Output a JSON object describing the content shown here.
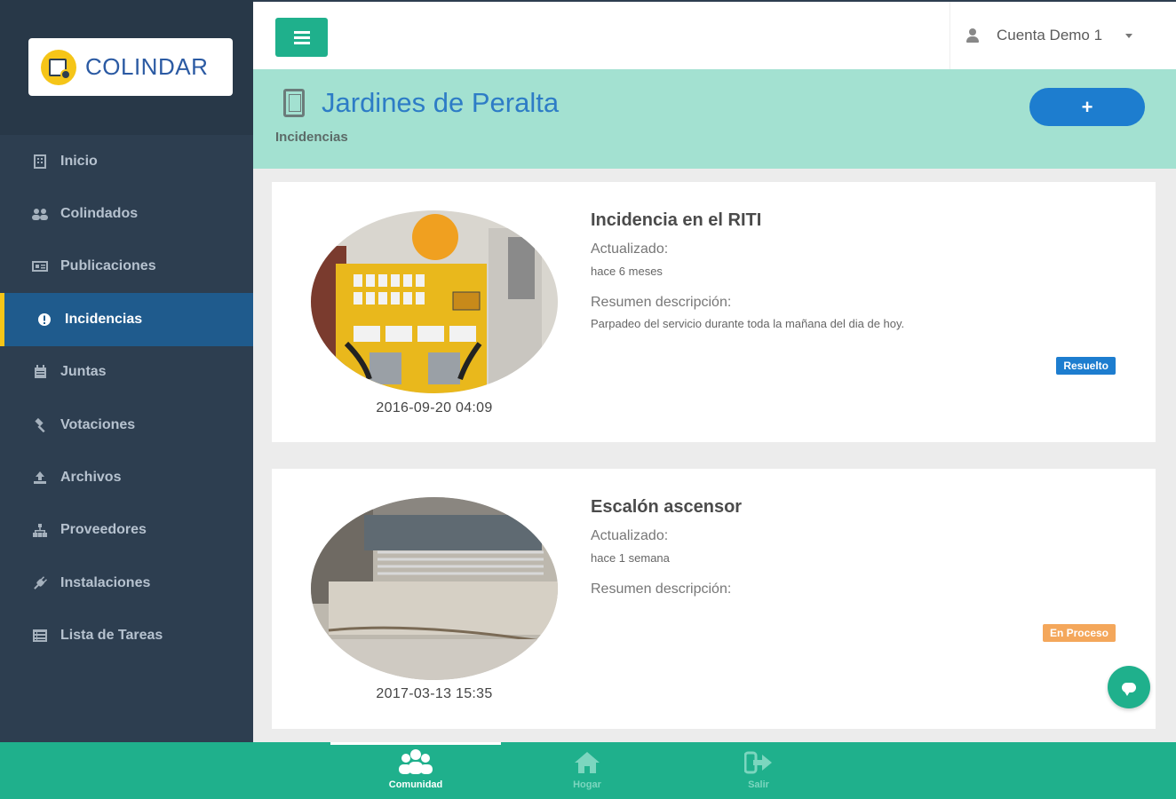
{
  "app": {
    "brand": "COLINDAR"
  },
  "sidebar": {
    "items": [
      {
        "label": "Inicio",
        "icon": "building-icon"
      },
      {
        "label": "Colindados",
        "icon": "users-icon"
      },
      {
        "label": "Publicaciones",
        "icon": "newspaper-icon"
      },
      {
        "label": "Incidencias",
        "icon": "exclamation-circle-icon",
        "active": true
      },
      {
        "label": "Juntas",
        "icon": "calendar-icon"
      },
      {
        "label": "Votaciones",
        "icon": "gavel-icon"
      },
      {
        "label": "Archivos",
        "icon": "upload-icon"
      },
      {
        "label": "Proveedores",
        "icon": "sitemap-icon"
      },
      {
        "label": "Instalaciones",
        "icon": "plug-icon"
      },
      {
        "label": "Lista de Tareas",
        "icon": "list-icon"
      }
    ]
  },
  "topbar": {
    "account": "Cuenta Demo 1"
  },
  "header": {
    "title": "Jardines de Peralta",
    "subtitle": "Incidencias",
    "add_label": "+"
  },
  "incidents": [
    {
      "title": "Incidencia en el RITI",
      "updated_label": "Actualizado:",
      "updated_value": "hace 6 meses",
      "summary_label": "Resumen descripción:",
      "summary_value": "Parpadeo del servicio durante toda la mañana del dia de hoy.",
      "status": "Resuelto",
      "date": "2016-09-20 04:09"
    },
    {
      "title": "Escalón ascensor",
      "updated_label": "Actualizado:",
      "updated_value": "hace 1 semana",
      "summary_label": "Resumen descripción:",
      "summary_value": "",
      "status": "En Proceso",
      "date": "2017-03-13 15:35"
    }
  ],
  "bottombar": {
    "tabs": [
      {
        "label": "Comunidad",
        "icon": "community-icon",
        "active": true
      },
      {
        "label": "Hogar",
        "icon": "home-icon"
      },
      {
        "label": "Salir",
        "icon": "logout-icon"
      }
    ]
  },
  "colors": {
    "accent": "#1fb08c",
    "sidebar": "#2d3e50",
    "header_band": "#a3e1d1",
    "primary": "#1d7dcf",
    "warning": "#f4a75b",
    "active_marker": "#f5c518"
  }
}
